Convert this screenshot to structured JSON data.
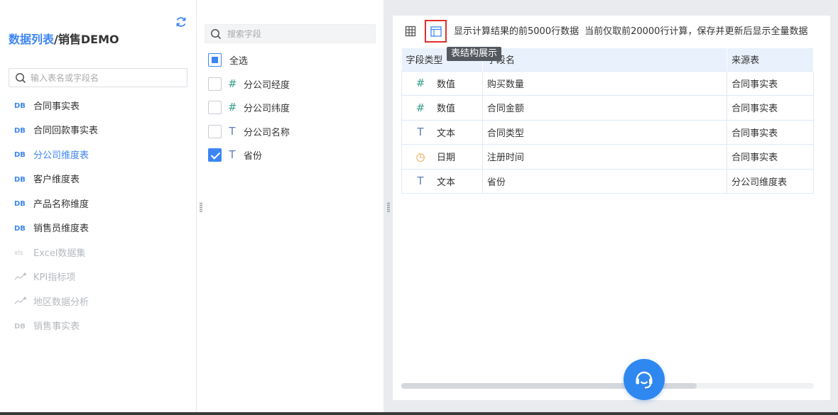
{
  "breadcrumb": {
    "link": "数据列表",
    "separator": "/",
    "current": "销售DEMO"
  },
  "table_search": {
    "placeholder": "输入表名或字段名",
    "value": ""
  },
  "tables": [
    {
      "label": "合同事实表",
      "icon": "db-icon",
      "state": "normal"
    },
    {
      "label": "合同回款事实表",
      "icon": "db-icon",
      "state": "normal"
    },
    {
      "label": "分公司维度表",
      "icon": "db-icon",
      "state": "active"
    },
    {
      "label": "客户维度表",
      "icon": "db-icon",
      "state": "normal"
    },
    {
      "label": "产品名称维度",
      "icon": "db-icon",
      "state": "normal"
    },
    {
      "label": "销售员维度表",
      "icon": "db-icon",
      "state": "normal"
    },
    {
      "label": "Excel数据集",
      "icon": "xls-icon",
      "state": "dim"
    },
    {
      "label": "KPI指标项",
      "icon": "trend-icon",
      "state": "dim"
    },
    {
      "label": "地区数据分析",
      "icon": "trend-icon",
      "state": "dim"
    },
    {
      "label": "销售事实表",
      "icon": "db-icon",
      "state": "dim"
    }
  ],
  "field_search": {
    "placeholder": "搜索字段",
    "value": ""
  },
  "select_all": {
    "label": "全选",
    "state": "partial"
  },
  "fields": [
    {
      "label": "分公司经度",
      "type_icon": "#",
      "checked": false
    },
    {
      "label": "分公司纬度",
      "type_icon": "#",
      "checked": false
    },
    {
      "label": "分公司名称",
      "type_icon": "T",
      "checked": false
    },
    {
      "label": "省份",
      "type_icon": "T",
      "checked": true
    }
  ],
  "toolbar": {
    "tooltip": "表结构展示",
    "preview_text_1": "显示计算结果的前5000行数据",
    "preview_text_2": "当前仅取前20000行计算，保存并更新后显示全量数据"
  },
  "structure_table": {
    "headers": [
      "字段类型",
      "字段名",
      "来源表"
    ],
    "rows": [
      {
        "type_icon": "#",
        "type": "数值",
        "field": "购买数量",
        "source": "合同事实表"
      },
      {
        "type_icon": "#",
        "type": "数值",
        "field": "合同金额",
        "source": "合同事实表"
      },
      {
        "type_icon": "T",
        "type": "文本",
        "field": "合同类型",
        "source": "合同事实表"
      },
      {
        "type_icon": "◷",
        "type": "日期",
        "field": "注册时间",
        "source": "合同事实表"
      },
      {
        "type_icon": "T",
        "type": "文本",
        "field": "省份",
        "source": "分公司维度表"
      }
    ]
  },
  "colors": {
    "accent": "#3d86f4",
    "highlight_border": "#e0302b",
    "number_icon": "#3b9e8f",
    "text_icon": "#5d7fb6",
    "date_icon": "#f09a3e",
    "help_button": "#2f88f0"
  }
}
